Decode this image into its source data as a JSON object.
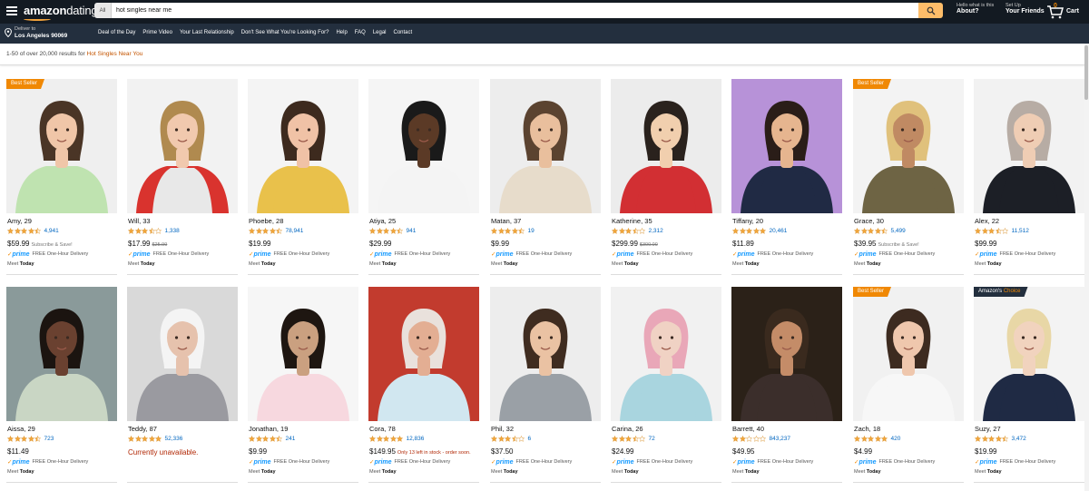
{
  "header": {
    "logo_bold": "amazon",
    "logo_light": "dating",
    "search_category": "All",
    "search_value": "hot singles near me",
    "account_small": "Hello what is this",
    "account_big": "About?",
    "setup_small": "Set Up",
    "setup_big": "Your Friends",
    "cart_count": "0",
    "cart_label": "Cart"
  },
  "subnav": {
    "deliver_line1": "Deliver to",
    "deliver_line2": "Los Angeles 90069",
    "links": [
      "Deal of the Day",
      "Prime Video",
      "Your Last Relationship",
      "Don't See What You're Looking For?",
      "Help",
      "FAQ",
      "Legal",
      "Contact"
    ]
  },
  "results": {
    "prefix": "1-50 of over 20,000 results for ",
    "query": "Hot Singles Near You"
  },
  "common": {
    "prime_label": "prime",
    "delivery": "FREE One-Hour Delivery",
    "meet_prefix": "Meet ",
    "meet_day": "Today"
  },
  "colors": {
    "accent_orange": "#f08804",
    "link_blue": "#0066c0",
    "nav_dark": "#131a22",
    "nav_mid": "#232f3e",
    "search_button": "#febd69",
    "warning_red": "#b12704"
  },
  "profiles": [
    {
      "name": "Amy, 29",
      "rating": 4.5,
      "reviews": "4,941",
      "price": "$59.99",
      "note": "Subscribe & Save!",
      "badge": "Best Seller",
      "prime": true,
      "bg": "#efefef",
      "skin": "#f0c6a8",
      "hair": "#4a3526",
      "shirt": "#bfe3b0"
    },
    {
      "name": "Will, 33",
      "rating": 3.5,
      "reviews": "1,338",
      "price": "$17.99",
      "old_price": "$25.99",
      "prime": true,
      "bg": "#f2f2f2",
      "skin": "#f1c9ae",
      "hair": "#b08a4f",
      "shirt": "#e8e8e8",
      "sleeve": "#d9332e"
    },
    {
      "name": "Phoebe, 28",
      "rating": 4.5,
      "reviews": "78,941",
      "price": "$19.99",
      "prime": true,
      "bg": "#f4f4f4",
      "skin": "#f0c2a6",
      "hair": "#3d2a1e",
      "shirt": "#e9c14b"
    },
    {
      "name": "Atiya, 25",
      "rating": 4.5,
      "reviews": "941",
      "price": "$29.99",
      "prime": true,
      "bg": "#f5f5f5",
      "skin": "#5b3a26",
      "hair": "#1a1a1a",
      "shirt": "#f4f4f4"
    },
    {
      "name": "Matan, 37",
      "rating": 4.5,
      "reviews": "19",
      "price": "$9.99",
      "prime": true,
      "bg": "#ededed",
      "skin": "#e9bf9d",
      "hair": "#5b4330",
      "shirt": "#e7dccb"
    },
    {
      "name": "Katherine, 35",
      "rating": 3.5,
      "reviews": "2,312",
      "price": "$299.99",
      "old_price": "$300.00",
      "prime": true,
      "bg": "#ececec",
      "skin": "#f1cfae",
      "hair": "#2a221d",
      "shirt": "#d22f33"
    },
    {
      "name": "Tiffany, 20",
      "rating": 5,
      "reviews": "20,461",
      "price": "$11.89",
      "prime": true,
      "bg": "#b792d8",
      "skin": "#e6b58f",
      "hair": "#2a1d18",
      "shirt": "#202a44"
    },
    {
      "name": "Grace, 30",
      "rating": 4.5,
      "reviews": "5,499",
      "price": "$39.95",
      "note": "Subscribe & Save!",
      "badge": "Best Seller",
      "prime": true,
      "bg": "#f3f3f3",
      "skin": "#c08a63",
      "hair": "#e0c17c",
      "shirt": "#6e6444"
    },
    {
      "name": "Alex, 22",
      "rating": 3.5,
      "reviews": "11,512",
      "price": "$99.99",
      "prime": true,
      "bg": "#f2f2f2",
      "skin": "#efcdb4",
      "hair": "#b7aca4",
      "shirt": "#1c1f26"
    },
    {
      "name": "Aissa, 29",
      "rating": 4.5,
      "reviews": "723",
      "price": "$11.49",
      "prime": true,
      "bg": "#8a9a9a",
      "skin": "#6a4130",
      "hair": "#1b1410",
      "shirt": "#c9d6c4"
    },
    {
      "name": "Teddy, 87",
      "rating": 5,
      "reviews": "52,336",
      "unavailable": "Currently unavailable.",
      "prime": false,
      "bg": "#d9d9d9",
      "skin": "#e6c2ad",
      "hair": "#f4f4f4",
      "shirt": "#9a9aa0"
    },
    {
      "name": "Jonathan, 19",
      "rating": 4.5,
      "reviews": "241",
      "price": "$9.99",
      "prime": true,
      "bg": "#f6f6f6",
      "skin": "#caa080",
      "hair": "#1e1611",
      "shirt": "#f7d8df"
    },
    {
      "name": "Cora, 78",
      "rating": 5,
      "reviews": "12,836",
      "price": "$149.95",
      "warning": "Only 13 left in stock - order soon.",
      "prime": true,
      "bg": "#c23b2e",
      "skin": "#e3ae93",
      "hair": "#e9e1dc",
      "shirt": "#d1e7f0"
    },
    {
      "name": "Phil, 32",
      "rating": 3.5,
      "reviews": "6",
      "price": "$37.50",
      "prime": true,
      "bg": "#ededed",
      "skin": "#eac2a3",
      "hair": "#3f2c20",
      "shirt": "#9aa0a6"
    },
    {
      "name": "Carina, 26",
      "rating": 3.5,
      "reviews": "72",
      "price": "$24.99",
      "prime": true,
      "bg": "#f1f1f1",
      "skin": "#f0d2c4",
      "hair": "#e9a7b8",
      "shirt": "#a9d5df"
    },
    {
      "name": "Barrett, 40",
      "rating": 2,
      "reviews": "843,237",
      "price": "$49.95",
      "prime": true,
      "bg": "#2b2118",
      "skin": "#c48c68",
      "hair": "#3a2a1e",
      "shirt": "#3b2e2b"
    },
    {
      "name": "Zach, 18",
      "rating": 5,
      "reviews": "420",
      "price": "$4.99",
      "badge": "Best Seller",
      "prime": true,
      "bg": "#f1f1f1",
      "skin": "#efc7ad",
      "hair": "#3d2b20",
      "shirt": "#f7f7f7"
    },
    {
      "name": "Suzy, 27",
      "rating": 4.5,
      "reviews": "3,472",
      "price": "$19.99",
      "badge": "Amazon's Choice",
      "prime": true,
      "bg": "#f3f3f3",
      "skin": "#f1d3be",
      "hair": "#e8d7a6",
      "shirt": "#1f2a44"
    }
  ]
}
